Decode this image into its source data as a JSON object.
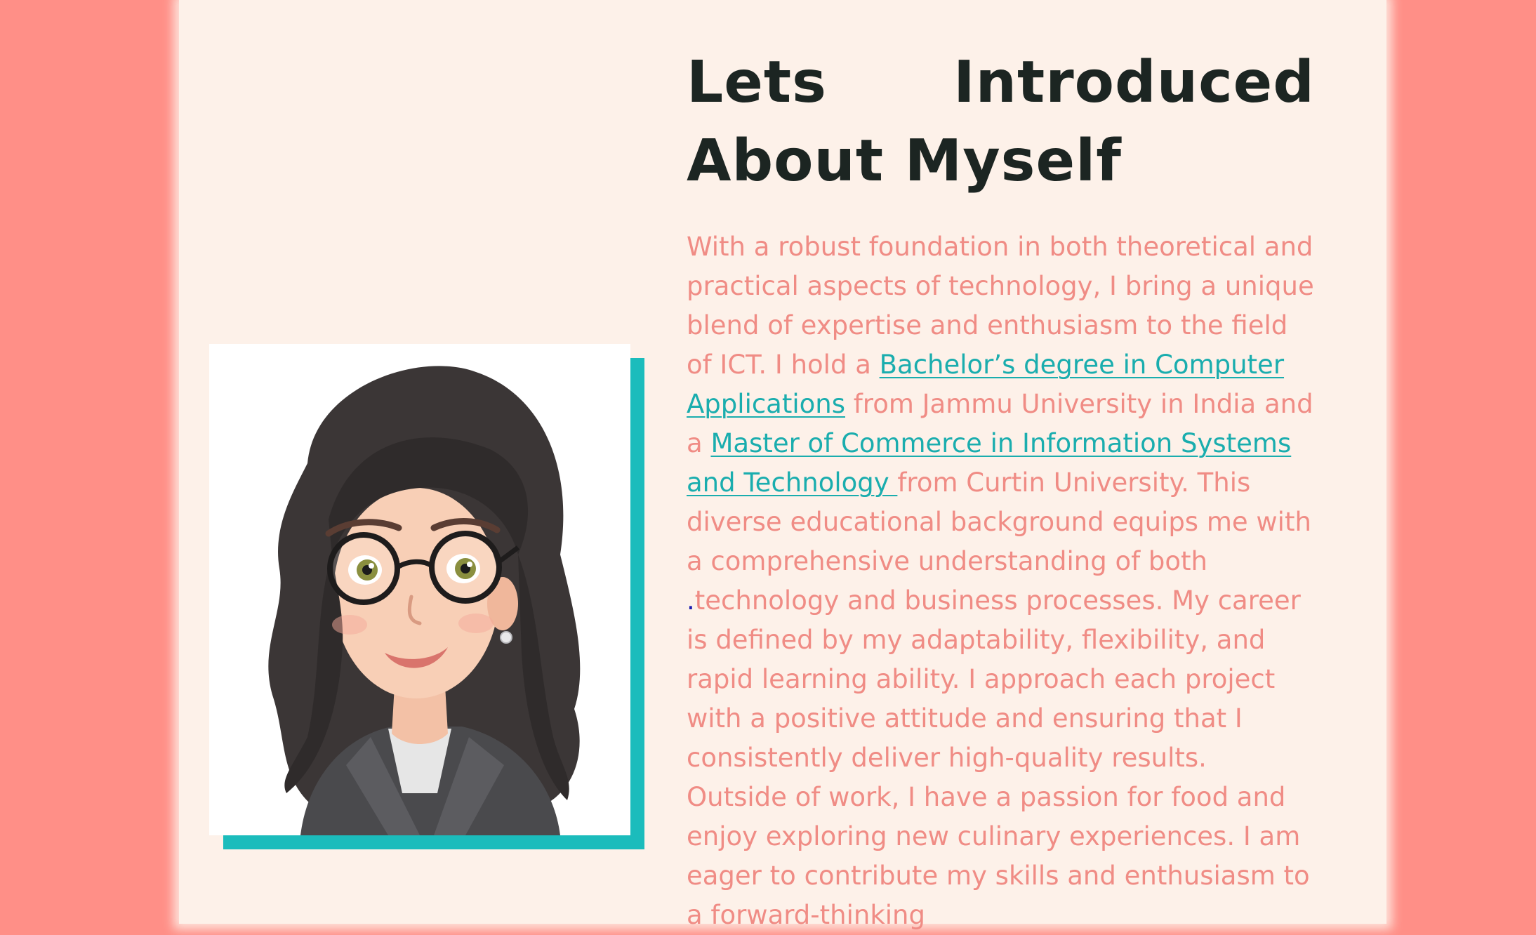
{
  "about": {
    "title": "Lets Introduced About Myself",
    "para_1": "With a robust foundation in both theoretical and practical aspects of technology, I bring a unique blend of expertise and enthusiasm to the field of ICT. I hold a ",
    "link_bachelor": "Bachelor’s degree in Computer Applications",
    "para_2": " from Jammu University in India and a ",
    "link_master": "Master of Commerce in Information Systems and Technology ",
    "para_3": "from Curtin University. This diverse educational background equips me with a comprehensive understanding of both",
    "para_dot": ".",
    "para_4": "technology and business processes. My career is defined by my adaptability, flexibility, and rapid learning ability. I approach each project with a positive attitude and ensuring that I consistently deliver high-quality results. Outside of work, I have a passion for food and enjoy exploring new culinary experiences. I am eager to contribute my skills and enthusiasm to a forward-thinking"
  },
  "colors": {
    "side_background": "#ff8f87",
    "page_background": "#fdf1e9",
    "accent_teal": "#1bbcbc",
    "body_text": "#f08c85",
    "heading_text": "#1c2522"
  },
  "icons": {
    "profile_image": "cartoon-avatar-woman-with-glasses"
  }
}
